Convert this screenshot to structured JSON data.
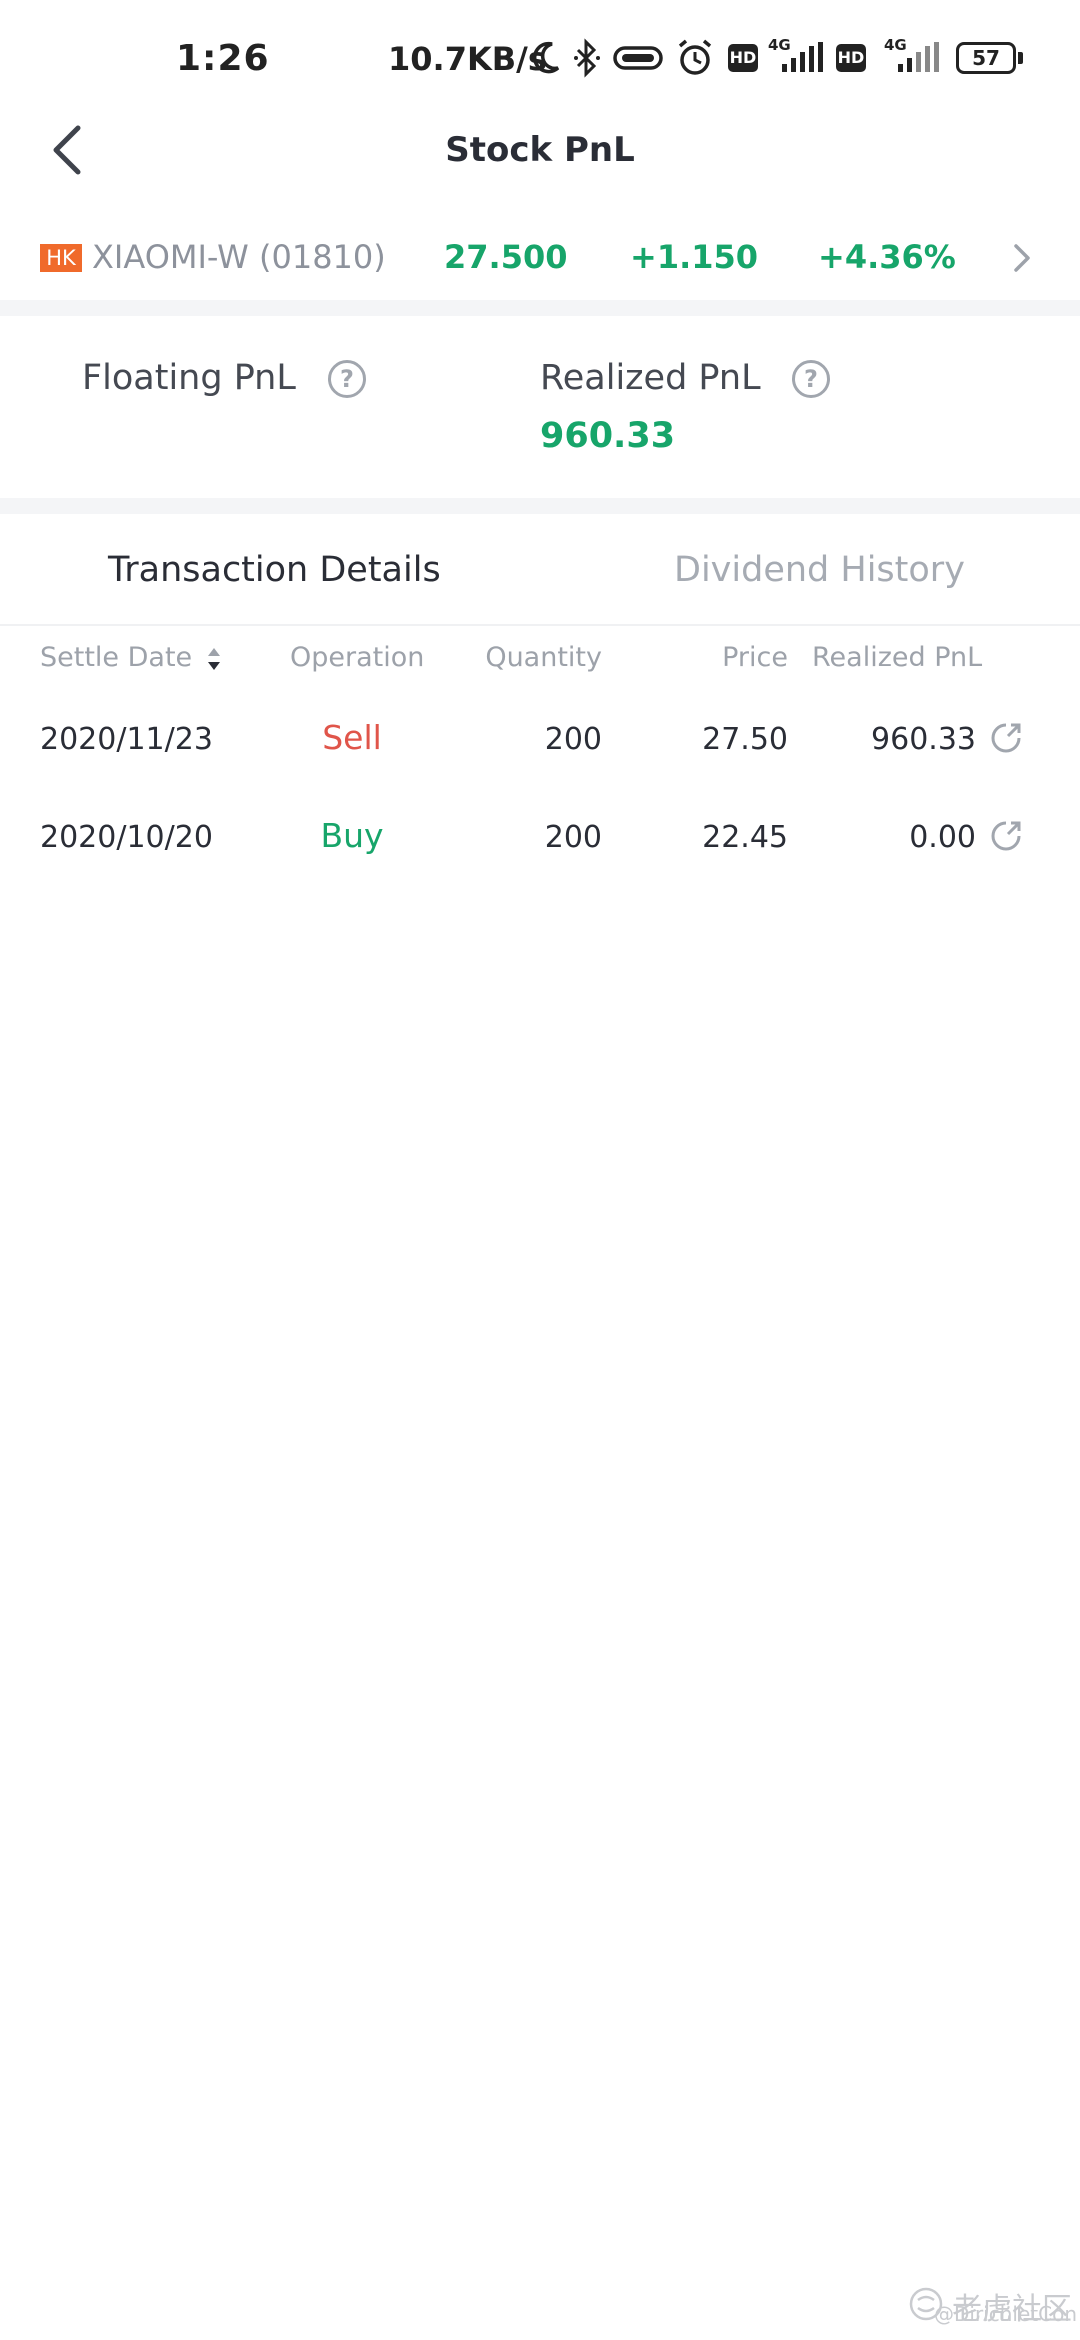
{
  "status_bar": {
    "time": "1:26",
    "net_speed": "10.7KB/s",
    "battery": "57",
    "signal_1": "4G",
    "signal_2": "4G",
    "hd_1": "HD",
    "hd_2": "HD"
  },
  "header": {
    "title": "Stock PnL",
    "back_icon": "chevron-left-icon"
  },
  "quote": {
    "market": "HK",
    "name": "XIAOMI-W (01810)",
    "price": "27.500",
    "change": "+1.150",
    "change_pct": "+4.36%",
    "color_up": "#17a56a",
    "badge_color": "#f06a2b"
  },
  "summary": {
    "floating_label": "Floating PnL",
    "realized_label": "Realized PnL",
    "realized_value": "960.33",
    "help_icon": "question-circle-icon"
  },
  "tabs": [
    {
      "label": "Transaction Details",
      "active": true
    },
    {
      "label": "Dividend History",
      "active": false
    }
  ],
  "table": {
    "headers": [
      "Settle Date",
      "Operation",
      "Quantity",
      "Price",
      "Realized PnL"
    ],
    "rows": [
      {
        "date": "2020/11/23",
        "operation": "Sell",
        "quantity": "200",
        "price": "27.50",
        "realized": "960.33"
      },
      {
        "date": "2020/10/20",
        "operation": "Buy",
        "quantity": "200",
        "price": "22.45",
        "realized": "0.00"
      }
    ],
    "sell_color": "#e0554a",
    "buy_color": "#17a56a"
  },
  "watermark": {
    "brand": "老虎社区",
    "handle": "@DirichletCon"
  }
}
